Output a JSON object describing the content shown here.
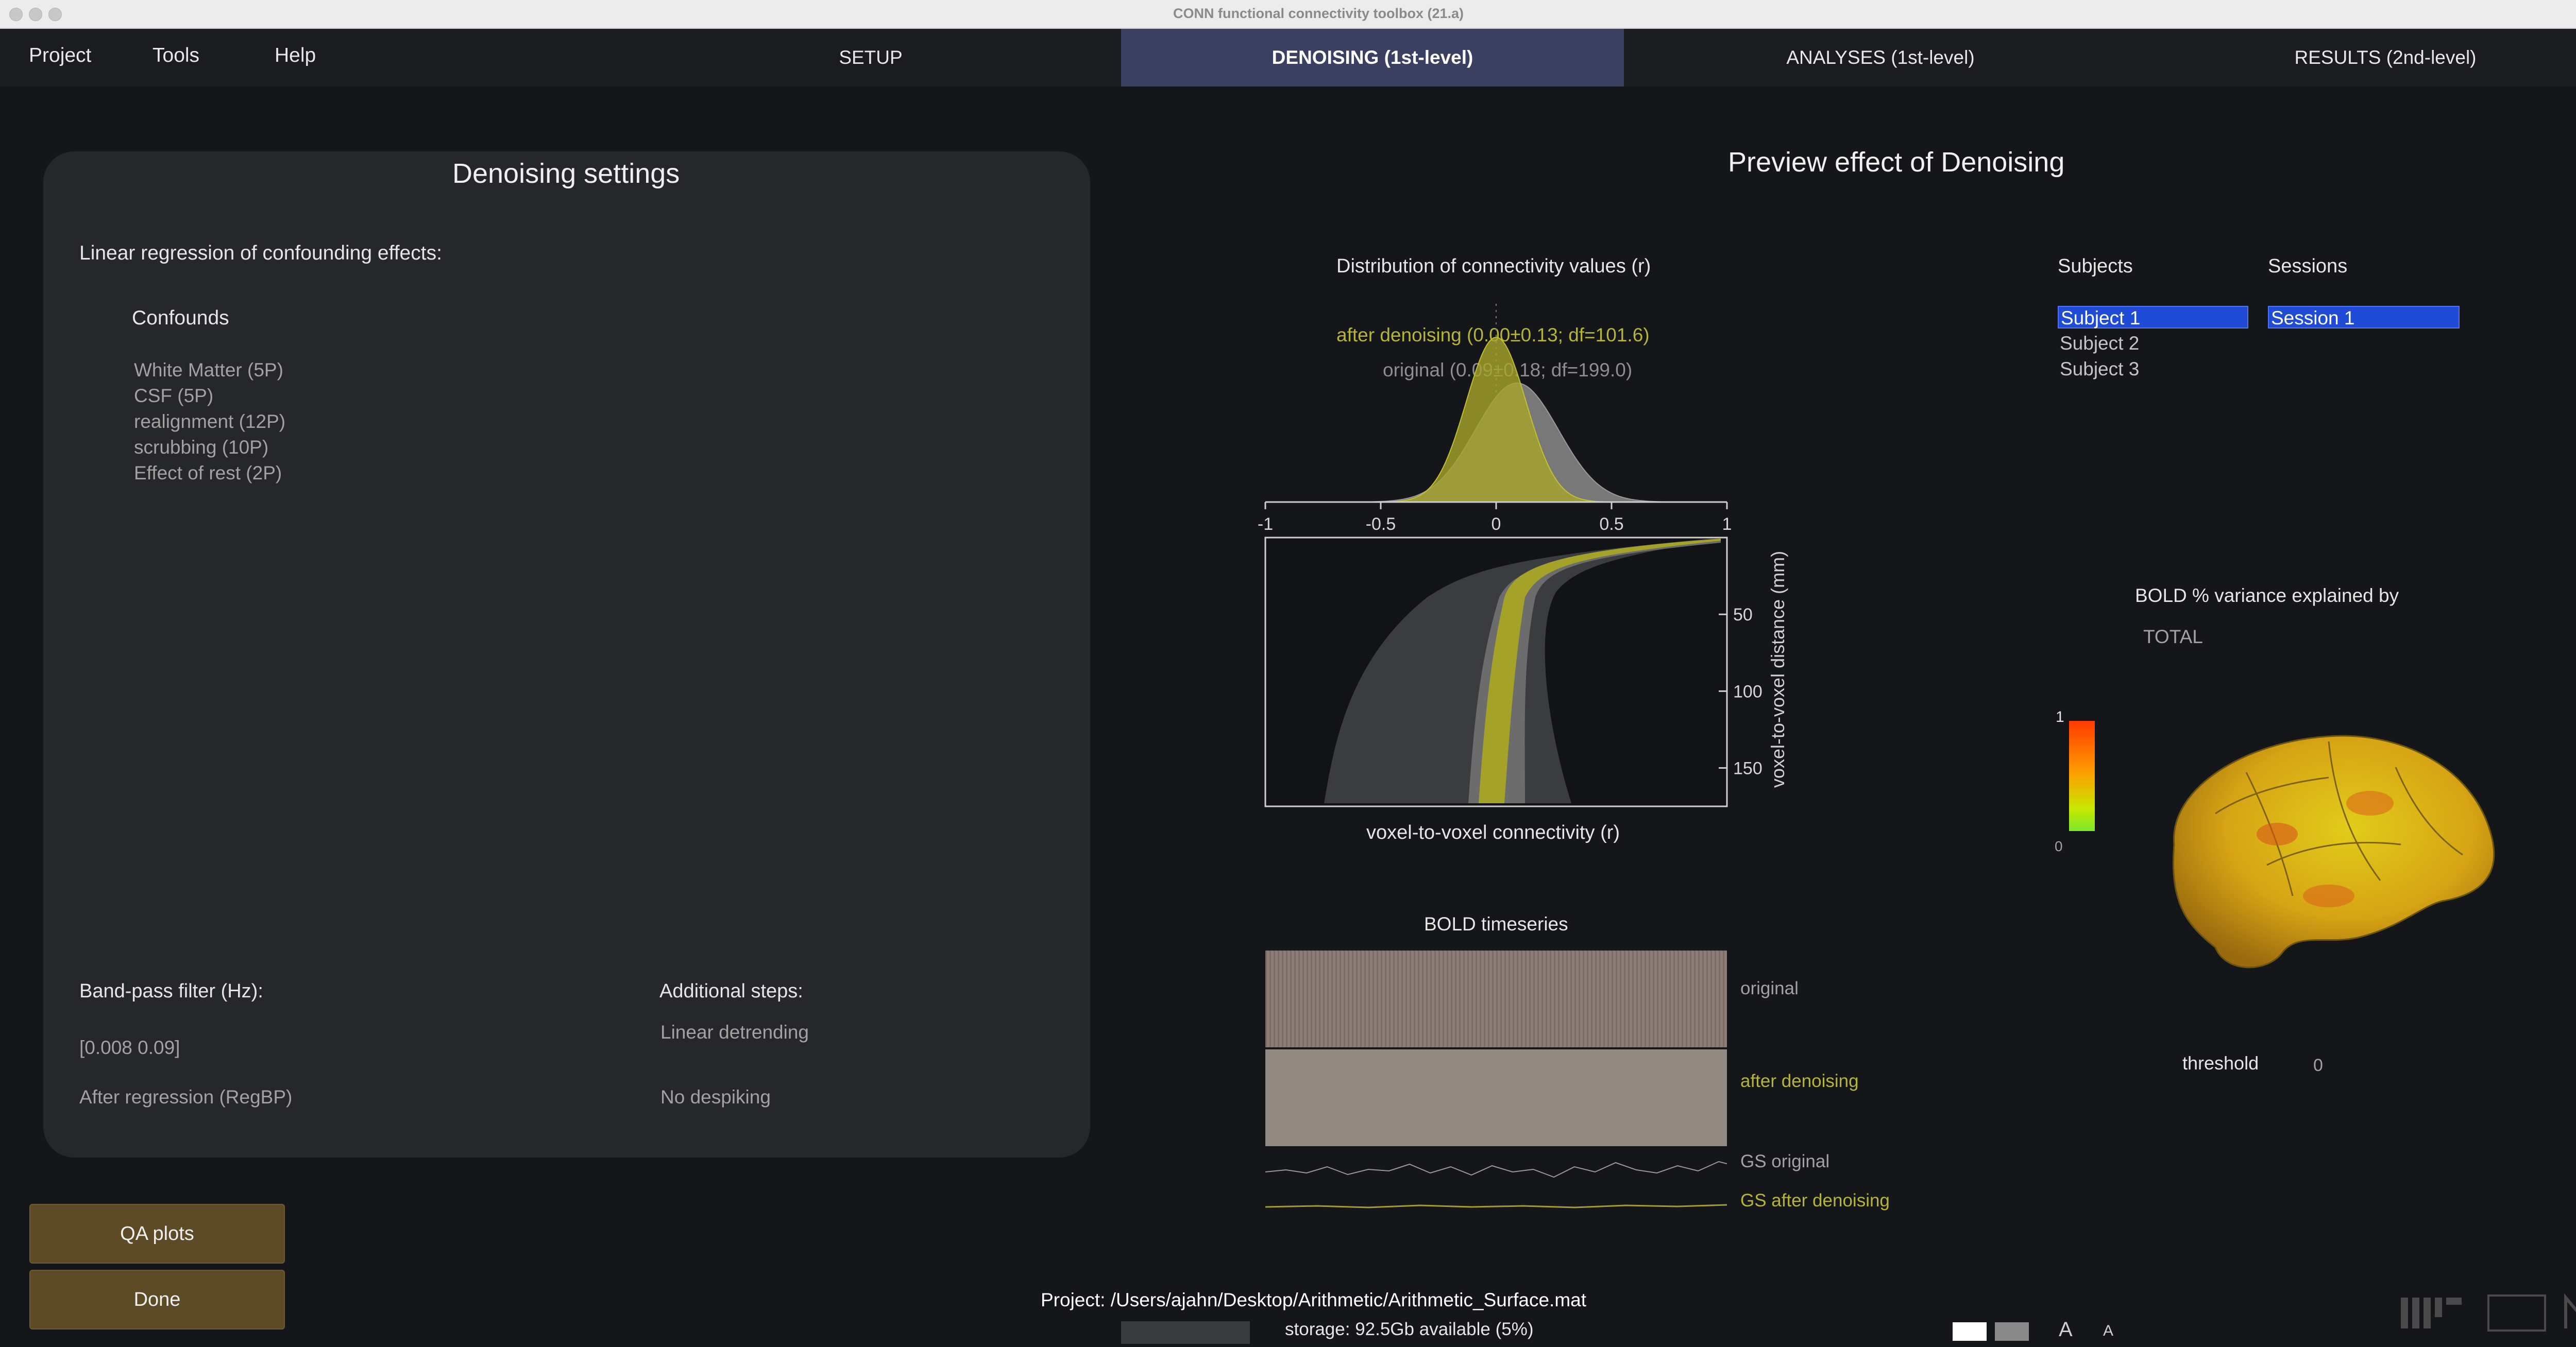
{
  "window": {
    "title": "CONN functional connectivity toolbox (21.a)"
  },
  "menu": {
    "items": [
      "Project",
      "Tools",
      "Help"
    ]
  },
  "tabs": [
    "SETUP",
    "DENOISING (1st-level)",
    "ANALYSES (1st-level)",
    "RESULTS (2nd-level)"
  ],
  "settings": {
    "title": "Denoising settings",
    "regression_label": "Linear regression of confounding effects:",
    "confounds_label": "Confounds",
    "confounds": [
      "White Matter (5P)",
      "CSF (5P)",
      "realignment (12P)",
      "scrubbing (10P)",
      "Effect of rest (2P)"
    ],
    "bandpass_label": "Band-pass filter (Hz):",
    "bandpass_value": "[0.008 0.09]",
    "bandpass_mode": "After regression (RegBP)",
    "additional_label": "Additional steps:",
    "additional_steps": [
      "Linear detrending",
      "No despiking"
    ]
  },
  "buttons": {
    "qa_plots": "QA plots",
    "done": "Done"
  },
  "preview": {
    "title": "Preview effect of Denoising",
    "dist_title": "Distribution of connectivity values (r)",
    "after_label": "after denoising (0.00±0.13; df=101.6)",
    "original_label": "original (0.09±0.18; df=199.0)",
    "x_ticks": [
      "-1",
      "-0.5",
      "0",
      "0.5",
      "1"
    ],
    "y_ticks": [
      "50",
      "100",
      "150"
    ],
    "xlabel": "voxel-to-voxel connectivity (r)",
    "ylabel": "voxel-to-voxel distance (mm)",
    "bold_title": "BOLD timeseries",
    "bold_labels": {
      "original": "original",
      "after": "after denoising",
      "gs_original": "GS original",
      "gs_after": "GS after denoising"
    }
  },
  "chart_data": {
    "type": "area",
    "title": "Distribution of connectivity values (r)",
    "xlabel": "voxel-to-voxel connectivity (r)",
    "xlim": [
      -1,
      1
    ],
    "series": [
      {
        "name": "after denoising (0.00±0.13; df=101.6)",
        "mean": 0.0,
        "sd": 0.13,
        "color": "#b9b62d"
      },
      {
        "name": "original (0.09±0.18; df=199.0)",
        "mean": 0.09,
        "sd": 0.18,
        "color": "#8a8a8a"
      }
    ]
  },
  "subjects": {
    "label": "Subjects",
    "items": [
      "Subject 1",
      "Subject 2",
      "Subject 3"
    ],
    "selected": "Subject 1"
  },
  "sessions": {
    "label": "Sessions",
    "items": [
      "Session 1"
    ],
    "selected": "Session 1"
  },
  "variance": {
    "title": "BOLD % variance explained by",
    "measure": "TOTAL",
    "colorbar_max": "1",
    "colorbar_min": "0",
    "threshold_label": "threshold",
    "threshold_value": "0"
  },
  "footer": {
    "project": "Project: /Users/ajahn/Desktop/Arithmetic/Arithmetic_Surface.mat",
    "storage": "storage: 92.5Gb available (5%)",
    "font_large": "A",
    "font_small": "A"
  },
  "colors": {
    "accent_tab": "#3b3f60",
    "button": "#5d4a26",
    "selection": "#1f4bd6",
    "after_denoising": "#b6b437"
  }
}
